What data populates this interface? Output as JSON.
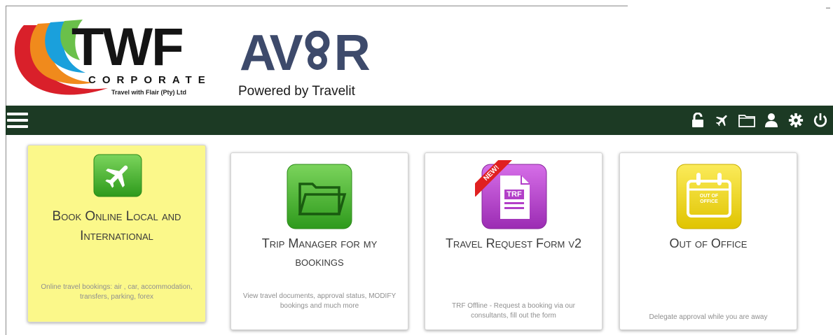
{
  "header": {
    "logo_primary": {
      "wordmark": "TWF",
      "subtitle": "CORPORATE",
      "tagline": "Travel with Flair (Pty) Ltd"
    },
    "logo_secondary": {
      "wordmark_left": "AV",
      "wordmark_right": "R",
      "powered_by": "Powered by Travelit"
    }
  },
  "navbar": {
    "background": "#1c3a24",
    "icons": [
      "unlock-icon",
      "airplane-icon",
      "folder-icon",
      "user-icon",
      "gear-icon",
      "power-icon"
    ]
  },
  "tiles": [
    {
      "title": "Book Online Local and International",
      "description": "Online travel bookings: air , car, accommodation, transfers, parking, forex",
      "icon": "airplane-icon",
      "active": true
    },
    {
      "title": "Trip Manager for my bookings",
      "description": "View travel documents, approval status, MODIFY bookings and much more",
      "icon": "folder-icon",
      "active": false
    },
    {
      "title": "Travel Request Form v2",
      "description": "TRF Offline - Request a booking via our consultants, fill out the form",
      "icon": "trf-document-icon",
      "badge": "NEW!",
      "icon_text": "TRF",
      "active": false
    },
    {
      "title": "Out of Office",
      "description": "Delegate approval while you are away",
      "icon": "calendar-icon",
      "icon_text": "OUT OF OFFICE",
      "active": false
    }
  ],
  "colors": {
    "active_tile": "#fbf88a",
    "green_icon": "#3fae2a",
    "purple_icon": "#b23fc8",
    "yellow_icon": "#f2d800",
    "badge_red": "#e02020"
  }
}
